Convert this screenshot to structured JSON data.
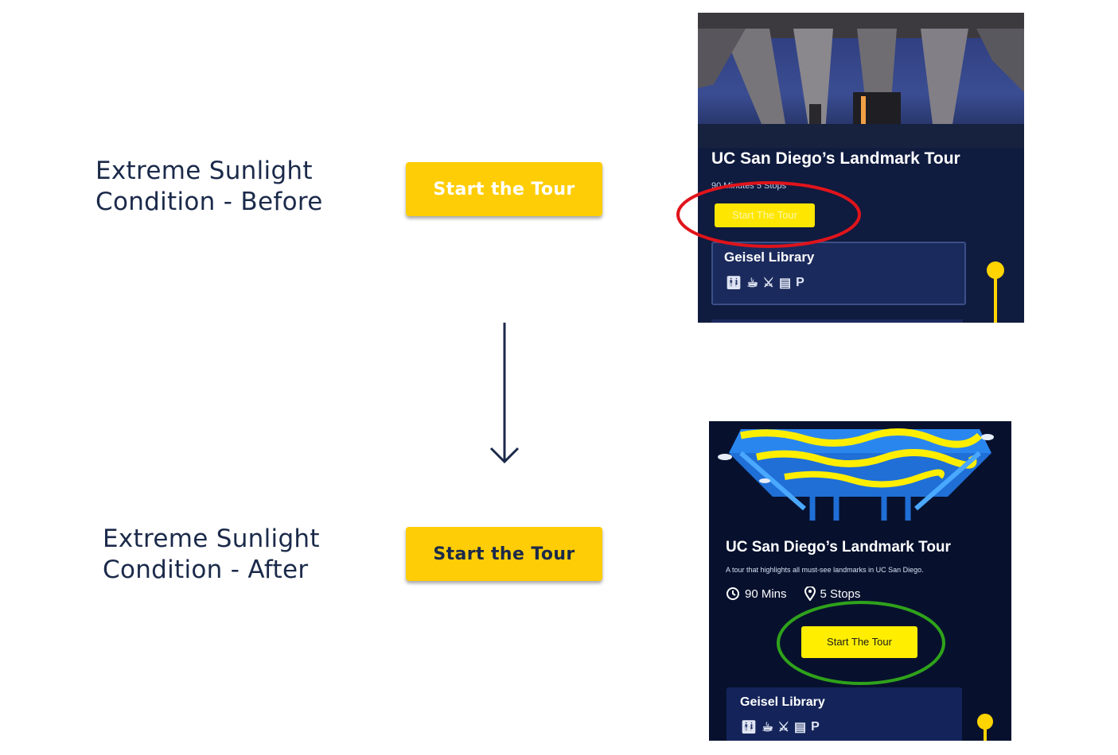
{
  "before": {
    "caption_line1": "Extreme Sunlight",
    "caption_line2": "Condition - Before",
    "cta_label": "Start the Tour",
    "phone": {
      "title": "UC San Diego’s Landmark Tour",
      "meta": "90 Minutes    5 Stops",
      "button_label": "Start The Tour",
      "stop_name": "Geisel Library",
      "amenities": [
        "restroom-icon",
        "cafe-icon",
        "dining-icon",
        "shop-icon",
        "parking-icon"
      ],
      "parking_label": "P"
    }
  },
  "after": {
    "caption_line1": "Extreme Sunlight",
    "caption_line2": "Condition - After",
    "cta_label": "Start the Tour",
    "phone": {
      "title": "UC San Diego’s Landmark Tour",
      "description": "A tour that highlights all must-see landmarks in UC San Diego.",
      "duration": "90 Mins",
      "stops": "5 Stops",
      "button_label": "Start The Tour",
      "stop_name": "Geisel Library",
      "amenities": [
        "restroom-icon",
        "cafe-icon",
        "dining-icon",
        "shop-icon",
        "parking-icon"
      ],
      "parking_label": "P"
    }
  },
  "colors": {
    "accent_yellow": "#ffcd05",
    "navy_text": "#1b2a4a",
    "before_ring": "#e0141b",
    "after_ring": "#2fa21a"
  }
}
